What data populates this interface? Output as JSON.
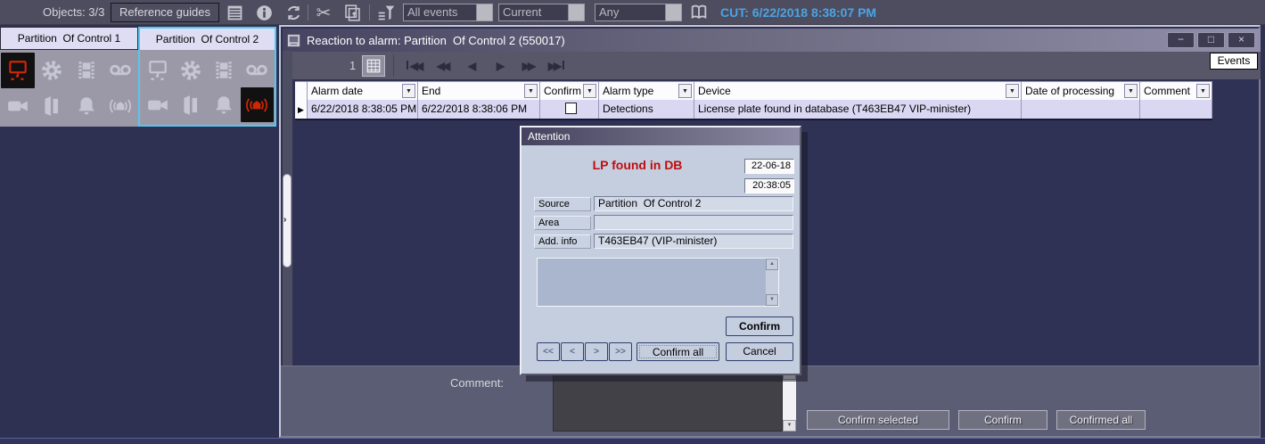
{
  "toolbar": {
    "objects_label": "Objects: 3/3",
    "reference_guides_button": "Reference guides",
    "filters": {
      "events": "All events",
      "current": "Current",
      "any": "Any"
    },
    "timestamp": "CUT: 6/22/2018 8:38:07 PM",
    "accent_color": "#4aa4e4"
  },
  "partitions": [
    {
      "title": "Partition  Of Control 1",
      "active_icon": "monitor-network-icon",
      "alarm_color": "#cf2606"
    },
    {
      "title": "Partition  Of Control 2",
      "active_icon": "siren-icon",
      "alarm_color": "#cf2606",
      "selected_border": "#54c8f2"
    }
  ],
  "alarm_window": {
    "title": "Reaction to alarm: Partition  Of Control 2 (550017)",
    "controls": {
      "minimize": "−",
      "maximize": "□",
      "close": "×"
    },
    "events_button": "Events",
    "page_number": "1",
    "nav_icons": [
      "◀◀",
      "◀◀",
      "◀",
      "▶",
      "▶▶",
      "▶▶"
    ],
    "table": {
      "columns": [
        "Alarm date",
        "End",
        "Confirm",
        "Alarm type",
        "Device",
        "Date of processing",
        "Comment"
      ],
      "row": {
        "alarm_date": "6/22/2018 8:38:05 PM",
        "end": "6/22/2018 8:38:06 PM",
        "confirm_checked": false,
        "alarm_type": "Detections",
        "device": "License plate found in database (T463EB47 VIP-minister)",
        "date_of_processing": "",
        "comment": ""
      }
    },
    "comment_label": "Comment:",
    "footer_buttons": [
      "Confirm selected",
      "Confirm",
      "Confirmed all"
    ]
  },
  "dialog": {
    "title": "Attention",
    "headline": "LP found in DB",
    "headline_color": "#c00c0c",
    "date": "22-06-18",
    "time": "20:38:05",
    "source_label": "Source",
    "source_value": "Partition  Of Control 2",
    "area_label": "Area",
    "area_value": "",
    "addinfo_label": "Add. info",
    "addinfo_value": "T463EB47 (VIP-minister)",
    "confirm_button": "Confirm",
    "nav_buttons": [
      "<<",
      "<",
      ">",
      ">>"
    ],
    "confirm_all_button": "Confirm all",
    "cancel_button": "Cancel"
  }
}
